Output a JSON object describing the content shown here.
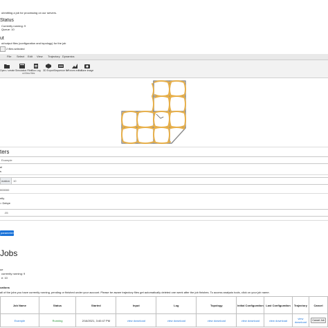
{
  "header": {
    "intro_text": "ubmitting a job for processing on our servers.",
    "status_title": "Status",
    "status_running": "Currently running: 9",
    "status_queue": "Queue: 10"
  },
  "input": {
    "section_title": "ut",
    "files_hint": "ut/output files (configuration and topology) for the job",
    "file_button": "Files",
    "file_selected": "2 files selected"
  },
  "viewer": {
    "tabs": [
      "File",
      "Select",
      "Edit",
      "View",
      "Trajectory",
      "Dynamics"
    ],
    "tools": [
      {
        "icon": "folder-open-icon",
        "label": "Open / create"
      },
      {
        "icon": "simulation-files-icon",
        "label": "Simulation Files"
      },
      {
        "icon": "run-log-icon",
        "label": "Run Log"
      },
      {
        "icon": "3d-export-icon",
        "label": "3D Export"
      },
      {
        "icon": "sequence-file-icon",
        "label": "Sequence file"
      },
      {
        "icon": "forces-editor-icon",
        "label": "Forces editor"
      },
      {
        "icon": "camera-icon",
        "label": "Save image"
      }
    ],
    "tool_group_label": "oxView files"
  },
  "parameters": {
    "title": "ters",
    "job_name_value": "Example",
    "label_a": "el",
    "label_b": "s",
    "steps_label": "mation",
    "steps_value": "10",
    "steps_value_b": "000000",
    "label_c": "ntly",
    "label_d": "= Debye",
    "salt_value": ".05",
    "submit_button": "parameters"
  },
  "jobs": {
    "title": "Jobs",
    "queue_label": "ue",
    "currently_running": "currently running: 9",
    "queue_count": "e: 10",
    "notifications_label": "cations",
    "notice_text": "all of the jobs you have currently running, pending or finished under your account. Please be aware trajectory files get automatically deleted one week after the job finishes. To access analysis tools, click on your job name.",
    "columns": [
      "Job Name",
      "Status",
      "Started",
      "Input",
      "Log",
      "Topology",
      "Initial Configuration",
      "Last Configuration",
      "Trajectory",
      "Cancel"
    ],
    "rows": [
      {
        "job_name": "Example",
        "status": "Running",
        "started": "2/16/2021, 3:40:47 PM",
        "input": "view download",
        "log": "view download",
        "topology": "view download",
        "initial": "view download",
        "last": "view download",
        "trajectory": "view download",
        "cancel": "Cancel Job"
      }
    ]
  },
  "colors": {
    "accent": "#1a73d9",
    "running": "#1e8f2e",
    "strand_a": "#e8b04a",
    "strand_b": "#7a7a7a"
  }
}
